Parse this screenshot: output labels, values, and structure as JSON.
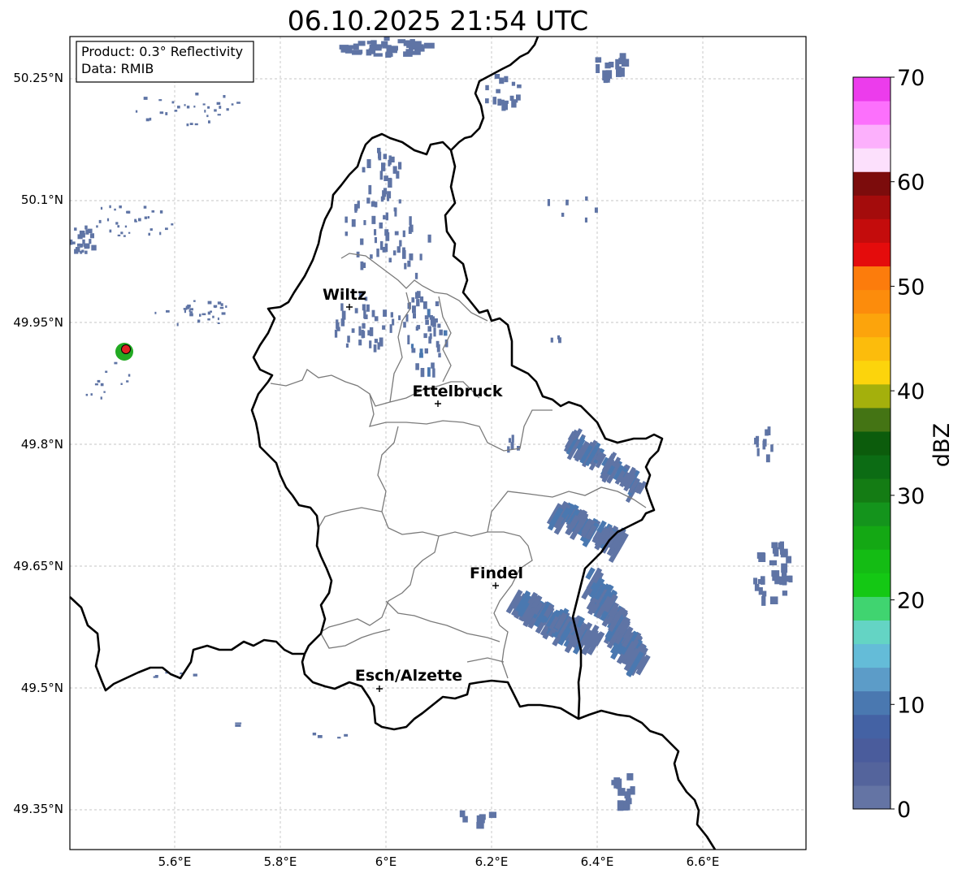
{
  "title": "06.10.2025 21:54 UTC",
  "info": {
    "product": "Product: 0.3° Reflectivity",
    "data": "Data: RMIB"
  },
  "lat_ticks": [
    "50.25°N",
    "50.1°N",
    "49.95°N",
    "49.8°N",
    "49.65°N",
    "49.5°N",
    "49.35°N"
  ],
  "lon_ticks": [
    "5.6°E",
    "5.8°E",
    "6°E",
    "6.2°E",
    "6.4°E",
    "6.6°E"
  ],
  "cities": [
    {
      "name": "Wiltz"
    },
    {
      "name": "Ettelbruck"
    },
    {
      "name": "Findel"
    },
    {
      "name": "Esch/Alzette"
    }
  ],
  "colorbar": {
    "label": "dBZ",
    "ticks": [
      "0",
      "10",
      "20",
      "30",
      "40",
      "50",
      "60",
      "70"
    ],
    "colors": [
      "#6474a4",
      "#54649c",
      "#4a5c9c",
      "#4462a4",
      "#4a78b0",
      "#5c9cc8",
      "#64bcd8",
      "#64d4c4",
      "#40d470",
      "#14c814",
      "#14bc14",
      "#14a814",
      "#14941c",
      "#147c14",
      "#0c6c14",
      "#0c5c0c",
      "#447414",
      "#a4b00c",
      "#fcd40c",
      "#fcbc0c",
      "#fca40c",
      "#fc8c0c",
      "#fc7c0c",
      "#e40c0c",
      "#c40c0c",
      "#a40c0c",
      "#7c0c0c",
      "#fce0fc",
      "#fcb0fc",
      "#fc70fc",
      "#ec3cec"
    ]
  },
  "echo_color": "#5f74a5",
  "echo_color_strong": "#4a78b0",
  "radar_marker": {
    "outer": "#22aa22",
    "inner": "#dd2222"
  }
}
